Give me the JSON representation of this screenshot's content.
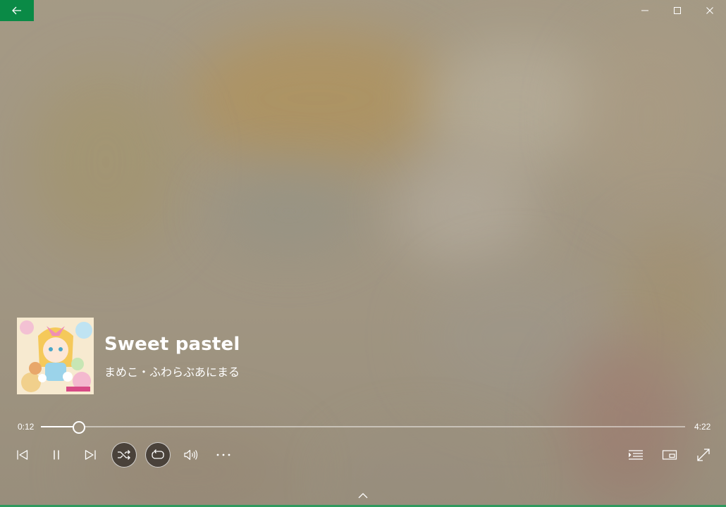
{
  "window": {
    "title": "Groove Music - Now Playing",
    "accent_color": "#0a8a46",
    "back_icon": "arrow-left-icon",
    "minimize_icon": "minimize-icon",
    "maximize_icon": "maximize-icon",
    "close_icon": "close-icon"
  },
  "now_playing": {
    "title": "Sweet pastel",
    "artist_line": "まめこ・ふわらぶあにまる"
  },
  "progress": {
    "elapsed": "0:12",
    "duration": "4:22",
    "fraction": 0.0576
  },
  "controls": {
    "previous_icon": "previous-track-icon",
    "pause_icon": "pause-icon",
    "next_icon": "next-track-icon",
    "shuffle_icon": "shuffle-icon",
    "shuffle_on": true,
    "repeat_icon": "repeat-icon",
    "repeat_on": true,
    "volume_icon": "volume-icon",
    "more_icon": "more-options-icon",
    "queue_icon": "now-playing-list-icon",
    "mini_view_icon": "mini-view-icon",
    "fullscreen_icon": "fullscreen-icon",
    "expand_icon": "chevron-up-icon"
  }
}
